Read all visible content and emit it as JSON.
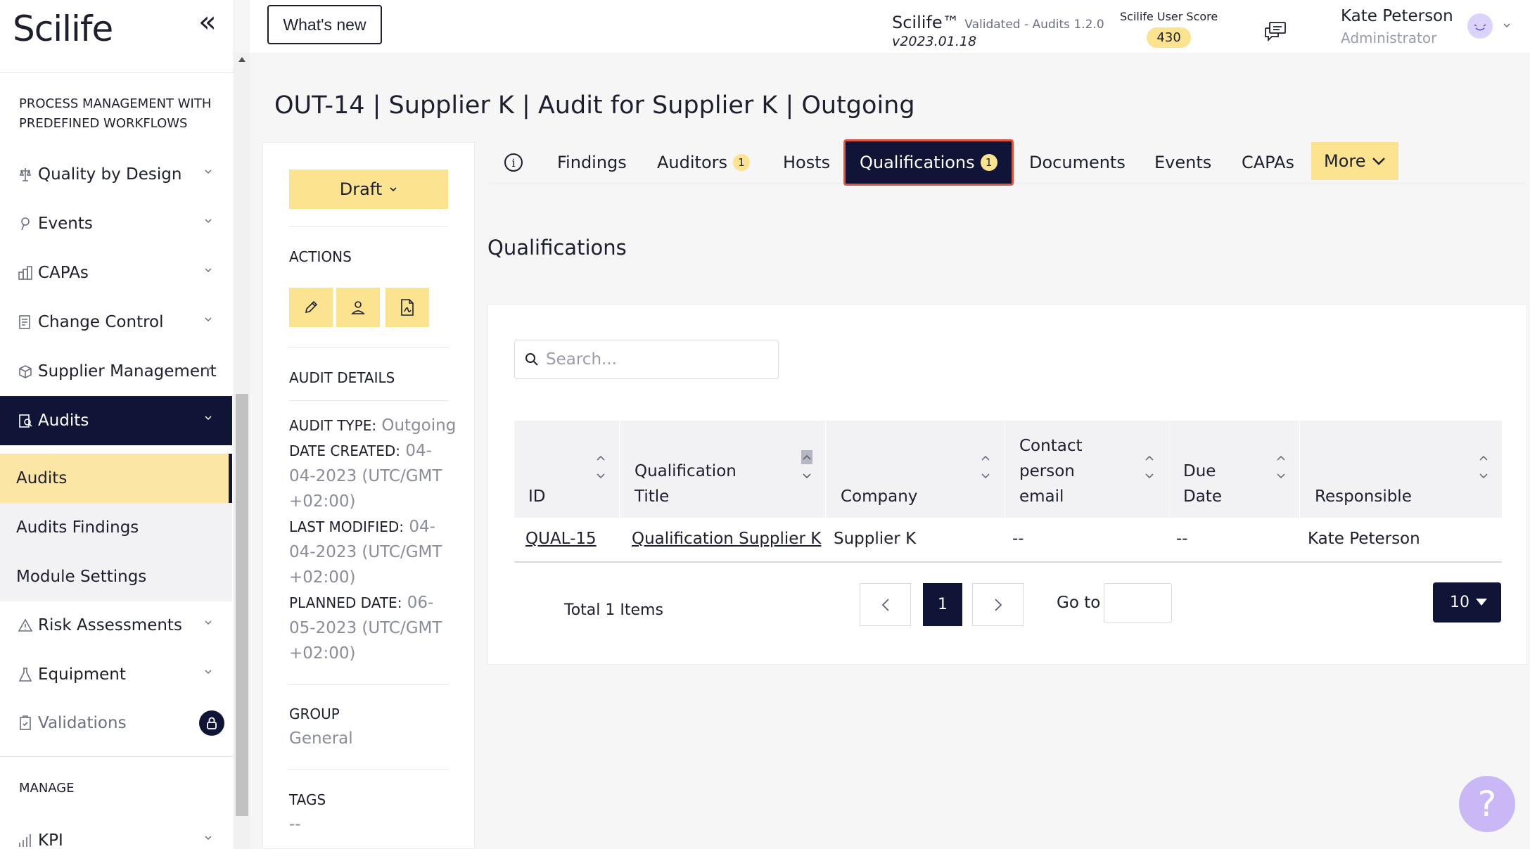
{
  "app": {
    "logo": "Scilife"
  },
  "sidebar": {
    "section_process": "PROCESS MANAGEMENT WITH PREDEFINED WORKFLOWS",
    "items": [
      {
        "label": "Quality by Design"
      },
      {
        "label": "Events"
      },
      {
        "label": "CAPAs"
      },
      {
        "label": "Change Control"
      },
      {
        "label": "Supplier Management"
      },
      {
        "label": "Audits"
      }
    ],
    "sub_items": [
      {
        "label": "Audits"
      },
      {
        "label": "Audits Findings"
      },
      {
        "label": "Module Settings"
      }
    ],
    "items_after": [
      {
        "label": "Risk Assessments"
      },
      {
        "label": "Equipment"
      },
      {
        "label": "Validations"
      }
    ],
    "section_manage": "MANAGE",
    "manage_items": [
      {
        "label": "KPI"
      }
    ]
  },
  "topbar": {
    "whats_new": "What's new",
    "product": "Scilife™",
    "product_note": "Validated - Audits 1.2.0",
    "version": "v2023.01.18",
    "score_label": "Scilife User Score",
    "score_value": "430",
    "user_name": "Kate Peterson",
    "user_role": "Administrator"
  },
  "page": {
    "title": "OUT-14 |  Supplier K |  Audit for Supplier K |  Outgoing"
  },
  "details": {
    "status": "Draft",
    "actions_head": "ACTIONS",
    "audit_details_head": "AUDIT DETAILS",
    "audit_type_k": "AUDIT TYPE:",
    "audit_type_v": "Outgoing",
    "date_created_k": "DATE CREATED:",
    "date_created_v": "04-04-2023 (UTC/GMT +02:00)",
    "last_modified_k": "LAST MODIFIED:",
    "last_modified_v": "04-04-2023 (UTC/GMT +02:00)",
    "planned_date_k": "PLANNED DATE:",
    "planned_date_v": "06-05-2023 (UTC/GMT +02:00)",
    "group_head": "GROUP",
    "group_value": "General",
    "tags_head": "TAGS",
    "tags_value": "--"
  },
  "tabs": {
    "findings": "Findings",
    "auditors": "Auditors",
    "auditors_badge": "1",
    "hosts": "Hosts",
    "qualifications": "Qualifications",
    "qualifications_badge": "1",
    "documents": "Documents",
    "events": "Events",
    "capas": "CAPAs",
    "more": "More"
  },
  "qualifications": {
    "section_title": "Qualifications",
    "search_placeholder": "Search...",
    "columns": {
      "id": "ID",
      "title_1": "Qualification",
      "title_2": "Title",
      "company": "Company",
      "contact_1": "Contact",
      "contact_2": "person",
      "contact_3": "email",
      "due_1": "Due",
      "due_2": "Date",
      "responsible": "Responsible"
    },
    "rows": [
      {
        "id": "QUAL-15",
        "title": "Qualification Supplier K",
        "company": "Supplier K",
        "contact": "--",
        "due": "--",
        "responsible": "Kate Peterson"
      }
    ],
    "total": "Total 1 Items",
    "current_page": "1",
    "goto_label": "Go to",
    "page_size": "10"
  },
  "help": {
    "label": "?"
  }
}
